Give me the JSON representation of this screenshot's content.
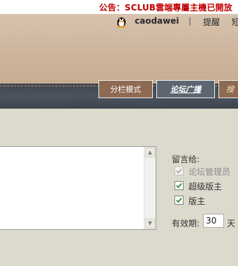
{
  "announcement": {
    "text": "公告：SCLUB雲端專屬主機已開放"
  },
  "userbar": {
    "username": "caodawei",
    "separator": "|",
    "reminder": "提醒",
    "short_message": "短",
    "qq_icon": "qq-penguin-icon"
  },
  "tabs": [
    {
      "label": "分栏模式"
    },
    {
      "label": "论坛广播"
    },
    {
      "label": "搜"
    }
  ],
  "message_form": {
    "textarea_value": "",
    "scroll_up_icon": "▲",
    "scroll_down_icon": "▼"
  },
  "recipients": {
    "label": "留言给:",
    "options": [
      {
        "label": "论坛管理员",
        "checked": true,
        "disabled": true
      },
      {
        "label": "超级版主",
        "checked": true,
        "disabled": false
      },
      {
        "label": "版主",
        "checked": true,
        "disabled": false
      }
    ]
  },
  "validity": {
    "label": "有效期:",
    "value": "30",
    "unit": "天"
  },
  "colors": {
    "announcement": "#c00000",
    "header": "#cdb59d",
    "tab_active": "#5b6670",
    "tab_inactive": "#8e6a52",
    "content_bg": "#dcd9cd",
    "checkmark": "#2e8b2e"
  }
}
